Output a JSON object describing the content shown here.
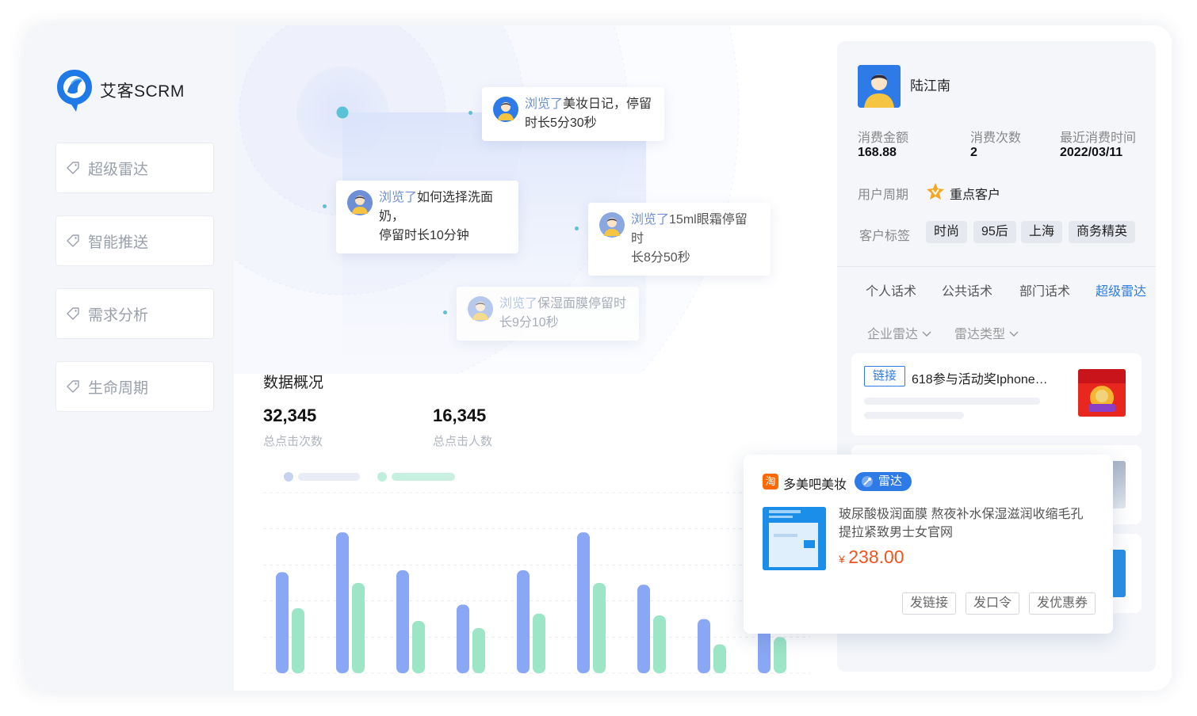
{
  "brand": {
    "name": "艾客SCRM"
  },
  "sidebar": {
    "items": [
      {
        "label": "超级雷达"
      },
      {
        "label": "智能推送"
      },
      {
        "label": "需求分析"
      },
      {
        "label": "生命周期"
      }
    ]
  },
  "activity": [
    {
      "prefix": "浏览了",
      "text": "美妆日记，停留",
      "text2": "时长5分30秒"
    },
    {
      "prefix": "浏览了",
      "text": "如何选择洗面奶，",
      "text2": "停留时长10分钟"
    },
    {
      "prefix": "浏览了",
      "text": "15ml眼霜停留时",
      "text2": "长8分50秒"
    },
    {
      "prefix": "浏览了",
      "text": "保湿面膜停留时",
      "text2": "长9分10秒"
    }
  ],
  "overview": {
    "title": "数据概况",
    "stats": [
      {
        "value": "32,345",
        "label": "总点击次数"
      },
      {
        "value": "16,345",
        "label": "总点击人数"
      }
    ]
  },
  "chart_data": {
    "type": "bar",
    "series": [
      {
        "values": [
          56,
          78,
          57,
          38,
          57,
          78,
          49,
          30,
          60
        ],
        "color": "#8aa7f5"
      },
      {
        "values": [
          36,
          50,
          29,
          25,
          33,
          50,
          32,
          16,
          20
        ],
        "color": "#9ce5c7"
      }
    ],
    "ylim": [
      0,
      100
    ],
    "grid": true
  },
  "customer": {
    "name": "陆江南",
    "fields": [
      {
        "label": "消费金额",
        "value": "168.88"
      },
      {
        "label": "消费次数",
        "value": "2"
      },
      {
        "label": "最近消费时间",
        "value": "2022/03/11"
      }
    ],
    "cycle_label": "用户周期",
    "cycle_value": "重点客户",
    "tags_label": "客户标签",
    "tags": [
      "时尚",
      "95后",
      "上海",
      "商务精英"
    ]
  },
  "tabs": [
    {
      "label": "个人话术"
    },
    {
      "label": "公共话术"
    },
    {
      "label": "部门话术"
    },
    {
      "label": "超级雷达"
    }
  ],
  "filters": [
    {
      "label": "企业雷达"
    },
    {
      "label": "雷达类型"
    }
  ],
  "card": {
    "badge": "链接",
    "title": "618参与活动奖Iphone…"
  },
  "popup": {
    "shop": "多美吧美妆",
    "badge": "雷达",
    "product": "玻尿酸极润面膜 熬夜补水保湿滋润收缩毛孔",
    "product2": "提拉紧致男士女官网",
    "currency": "¥",
    "price": "238.00",
    "actions": [
      {
        "label": "发链接"
      },
      {
        "label": "发口令"
      },
      {
        "label": "发优惠券"
      }
    ]
  },
  "colors": {
    "accent": "#2e7be8",
    "price": "#f0541e",
    "bar_blue": "#8aa7f5",
    "bar_green": "#9ce5c7"
  }
}
